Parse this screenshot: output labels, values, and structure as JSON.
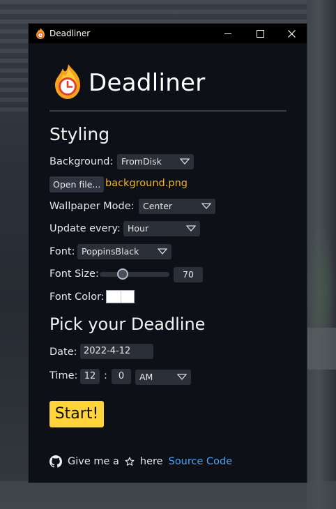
{
  "window": {
    "title": "Deadliner"
  },
  "brand": {
    "name": "Deadliner"
  },
  "styling": {
    "heading": "Styling",
    "background_label": "Background:",
    "background_value": "FromDisk",
    "open_file_label": "Open file...",
    "file_name": "background.png",
    "wallpaper_mode_label": "Wallpaper Mode:",
    "wallpaper_mode_value": "Center",
    "update_every_label": "Update every:",
    "update_every_value": "Hour",
    "font_label": "Font:",
    "font_value": "PoppinsBlack",
    "font_size_label": "Font Size:",
    "font_size_value": "70",
    "font_size_fraction": 0.3,
    "font_color_label": "Font Color:",
    "font_color": "#ffffff"
  },
  "deadline": {
    "heading": "Pick your Deadline",
    "date_label": "Date:",
    "date_value": "2022-4-12",
    "time_label": "Time:",
    "hour_value": "12",
    "separator": ":",
    "minute_value": "0",
    "ampm_value": "AM"
  },
  "actions": {
    "start_label": "Start!"
  },
  "footer": {
    "text_before_star": "Give me a",
    "text_after_star": "here",
    "link_label": "Source Code"
  },
  "colors": {
    "accent_yellow": "#ffd43b",
    "file_name": "#f0b429",
    "link": "#4ca3f5",
    "panel_bg": "#0d1017"
  },
  "icons": {
    "app": "flame-clock-icon",
    "github": "github-icon",
    "star": "star-icon",
    "dropdown": "chevron-down-icon"
  }
}
